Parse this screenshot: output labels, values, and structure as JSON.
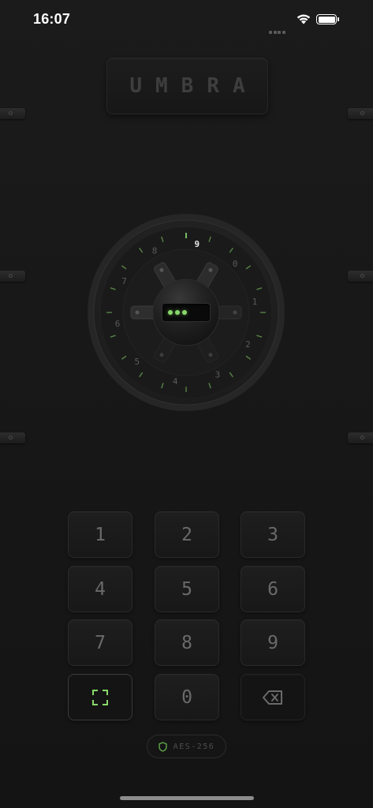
{
  "status_bar": {
    "time": "16:07",
    "icons": [
      "signal-dots-icon",
      "wifi-icon",
      "battery-icon"
    ]
  },
  "brand": {
    "name": "UMBRA"
  },
  "dial": {
    "numbers": [
      "0",
      "1",
      "2",
      "3",
      "4",
      "5",
      "6",
      "7",
      "8",
      "9"
    ],
    "highlighted_number": "9",
    "pin_entered_count": 3
  },
  "keypad": {
    "keys": [
      {
        "label": "1",
        "type": "digit"
      },
      {
        "label": "2",
        "type": "digit"
      },
      {
        "label": "3",
        "type": "digit"
      },
      {
        "label": "4",
        "type": "digit"
      },
      {
        "label": "5",
        "type": "digit"
      },
      {
        "label": "6",
        "type": "digit"
      },
      {
        "label": "7",
        "type": "digit"
      },
      {
        "label": "8",
        "type": "digit"
      },
      {
        "label": "9",
        "type": "digit"
      },
      {
        "label": "",
        "type": "scan",
        "icon": "scan-frame-icon"
      },
      {
        "label": "0",
        "type": "digit"
      },
      {
        "label": "",
        "type": "backspace",
        "icon": "backspace-icon"
      }
    ]
  },
  "badge": {
    "text": "AES-256",
    "icon": "shield-icon"
  },
  "colors": {
    "accent": "#88d86a",
    "background": "#171717",
    "key_text": "#6a6a6a"
  }
}
